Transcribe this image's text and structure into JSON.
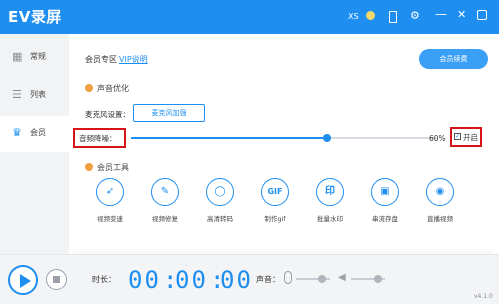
{
  "app": {
    "title": "EV录屏",
    "user_label": "XS"
  },
  "sidebar": {
    "items": [
      {
        "label": "常规",
        "icon": "grid-icon"
      },
      {
        "label": "列表",
        "icon": "list-icon"
      },
      {
        "label": "会员",
        "icon": "crown-icon",
        "active": true
      }
    ]
  },
  "member": {
    "zone_title": "会员专区",
    "vip_link": "VIP说明",
    "renew_label": "会员续费"
  },
  "audio": {
    "section_title": "声音优化",
    "mic_setting_label": "麦克风设置：",
    "mic_boost_label": "麦克风加强",
    "denoise_label": "音频降噪：",
    "denoise_level_percent": 60,
    "denoise_value_text": "60%",
    "enable_label": "开启",
    "enable_checked": true
  },
  "tools": {
    "section_title": "会员工具",
    "items": [
      {
        "label": "视频变速",
        "icon": "rocket-icon",
        "glyph": "➶"
      },
      {
        "label": "视频修复",
        "icon": "wrench-icon",
        "glyph": "✎"
      },
      {
        "label": "高清转码",
        "icon": "circle-icon",
        "glyph": "◯"
      },
      {
        "label": "制作gif",
        "icon": "gif-icon",
        "glyph": "GIF"
      },
      {
        "label": "批量水印",
        "icon": "watermark-icon",
        "glyph": "印"
      },
      {
        "label": "串流存盘",
        "icon": "save-icon",
        "glyph": "▣"
      },
      {
        "label": "直播视频",
        "icon": "camera-icon",
        "glyph": "◉"
      }
    ]
  },
  "bottom": {
    "duration_label": "时长：",
    "time_hh": "00",
    "time_mm": "00",
    "time_ss": "00",
    "sound_label": "声音：",
    "version": "v4.1.0"
  },
  "colors": {
    "accent": "#1e8ff0",
    "highlight": "#d8141b",
    "section_dot": "#f0a040"
  }
}
